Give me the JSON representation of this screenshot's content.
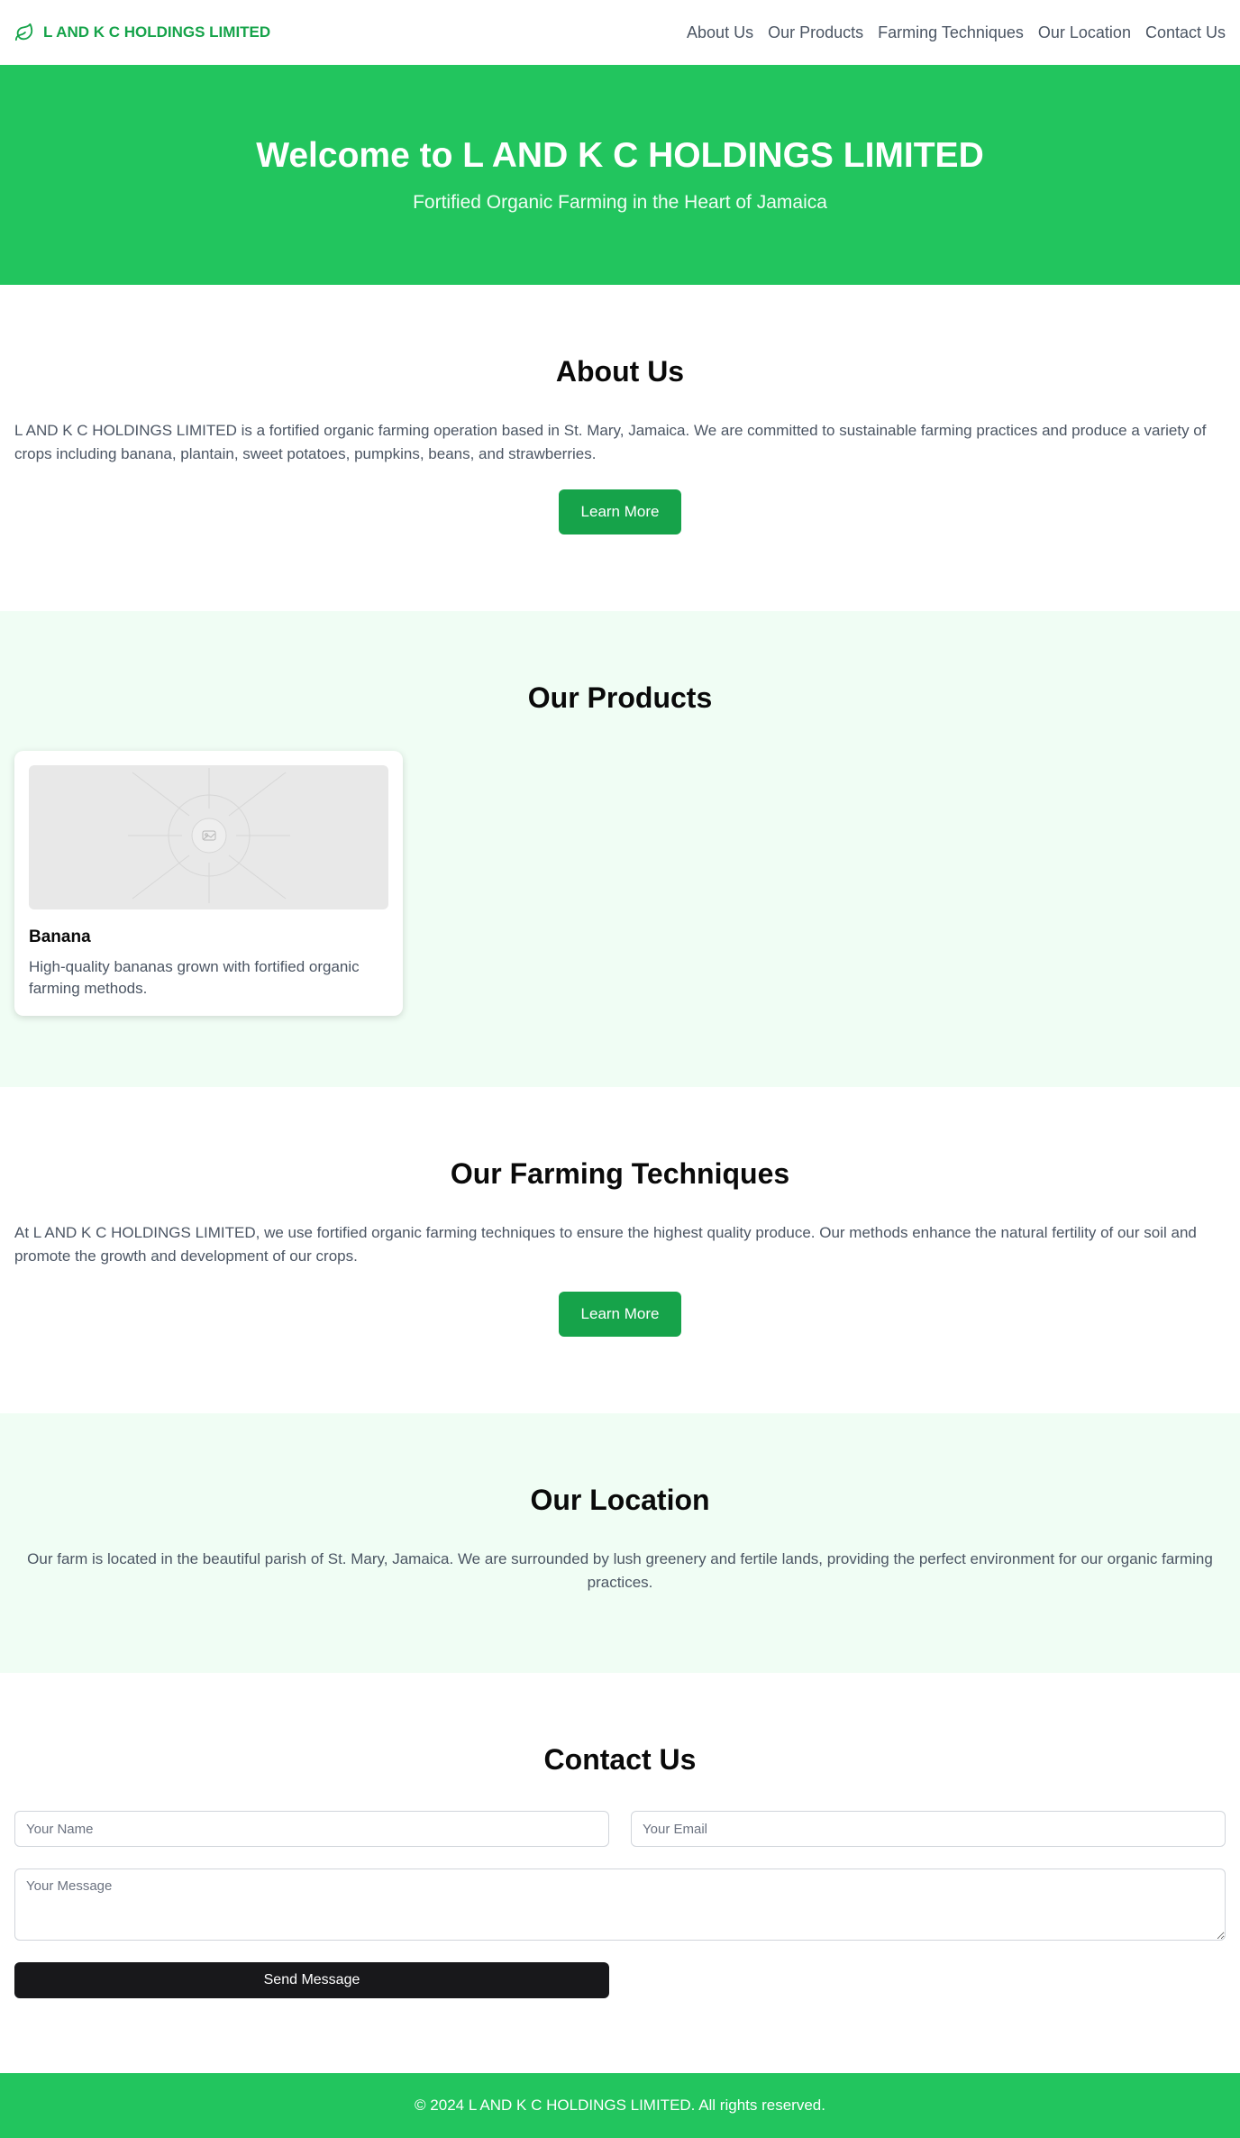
{
  "header": {
    "brand": "L AND K C HOLDINGS LIMITED",
    "brand_icon": "leaf-icon",
    "nav": [
      {
        "label": "About Us"
      },
      {
        "label": "Our Products"
      },
      {
        "label": "Farming Techniques"
      },
      {
        "label": "Our Location"
      },
      {
        "label": "Contact Us"
      }
    ]
  },
  "hero": {
    "title": "Welcome to L AND K C HOLDINGS LIMITED",
    "subtitle": "Fortified Organic Farming in the Heart of Jamaica"
  },
  "about": {
    "title": "About Us",
    "text": "L AND K C HOLDINGS LIMITED is a fortified organic farming operation based in St. Mary, Jamaica. We are committed to sustainable farming practices and produce a variety of crops including banana, plantain, sweet potatoes, pumpkins, beans, and strawberries.",
    "button": "Learn More"
  },
  "products": {
    "title": "Our Products",
    "items": [
      {
        "name": "Banana",
        "description": "High-quality bananas grown with fortified organic farming methods.",
        "image_icon": "image-placeholder-icon"
      }
    ]
  },
  "techniques": {
    "title": "Our Farming Techniques",
    "text": "At L AND K C HOLDINGS LIMITED, we use fortified organic farming techniques to ensure the highest quality produce. Our methods enhance the natural fertility of our soil and promote the growth and development of our crops.",
    "button": "Learn More"
  },
  "location": {
    "title": "Our Location",
    "text": "Our farm is located in the beautiful parish of St. Mary, Jamaica. We are surrounded by lush greenery and fertile lands, providing the perfect environment for our organic farming practices."
  },
  "contact": {
    "title": "Contact Us",
    "name_placeholder": "Your Name",
    "email_placeholder": "Your Email",
    "message_placeholder": "Your Message",
    "button": "Send Message"
  },
  "footer": {
    "text": "© 2024 L AND K C HOLDINGS LIMITED. All rights reserved."
  },
  "colors": {
    "primary_green": "#22c55e",
    "button_green": "#16a34a",
    "light_green_bg": "#f0fdf4",
    "dark_button": "#18181b",
    "body_text": "#4b5563"
  }
}
